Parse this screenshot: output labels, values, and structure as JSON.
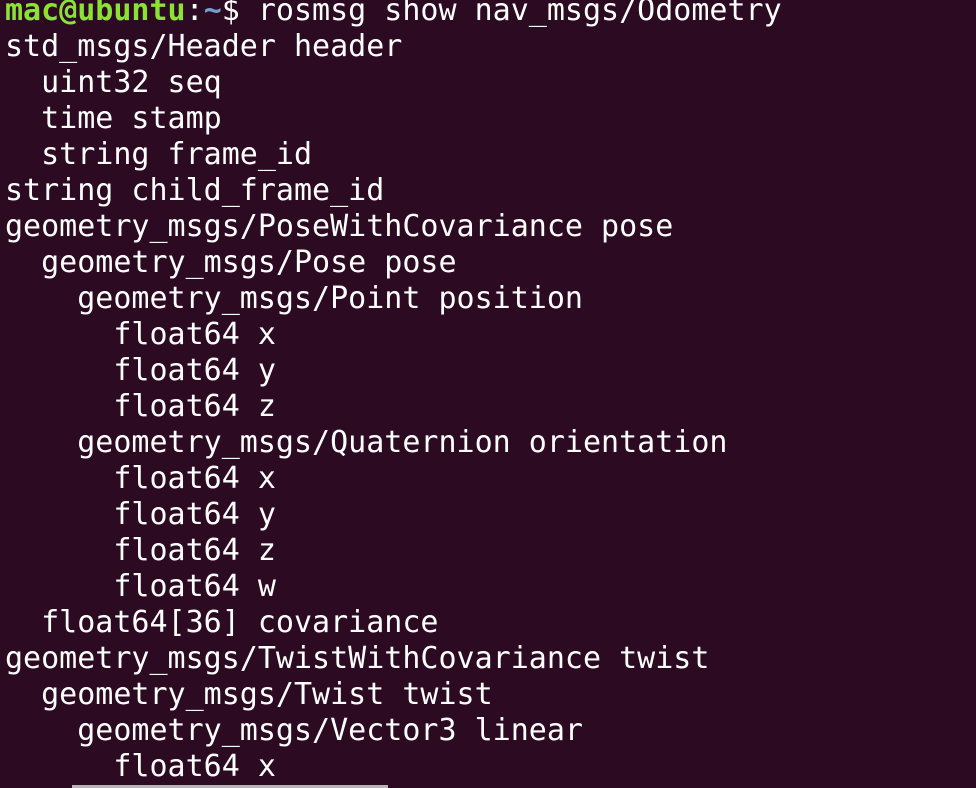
{
  "prompt": {
    "user_host": "mac@ubuntu",
    "separator": ":",
    "path": "~",
    "symbol": "$ ",
    "command": "rosmsg show nav_msgs/Odometry"
  },
  "output_lines": [
    "std_msgs/Header header",
    "  uint32 seq",
    "  time stamp",
    "  string frame_id",
    "string child_frame_id",
    "geometry_msgs/PoseWithCovariance pose",
    "  geometry_msgs/Pose pose",
    "    geometry_msgs/Point position",
    "      float64 x",
    "      float64 y",
    "      float64 z",
    "    geometry_msgs/Quaternion orientation",
    "      float64 x",
    "      float64 y",
    "      float64 z",
    "      float64 w",
    "  float64[36] covariance",
    "geometry_msgs/TwistWithCovariance twist",
    "  geometry_msgs/Twist twist",
    "    geometry_msgs/Vector3 linear",
    "      float64 x"
  ],
  "colors": {
    "background": "#2c0a22",
    "prompt_user": "#8ae234",
    "prompt_path": "#729fcf",
    "text": "#ffffff"
  }
}
